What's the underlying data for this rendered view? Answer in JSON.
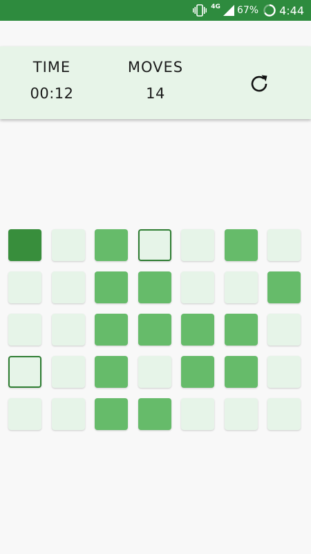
{
  "status_bar": {
    "network": "4G",
    "battery": "67%",
    "time": "4:44",
    "icons": [
      "vibrate-icon",
      "signal-icon",
      "battery-icon"
    ]
  },
  "header": {
    "time_label": "TIME",
    "time_value": "00:12",
    "moves_label": "MOVES",
    "moves_value": "14",
    "restart_icon": "refresh-icon"
  },
  "colors": {
    "status_bar": "#2e8b3e",
    "header_bg": "#e7f4e8",
    "tile_empty": "#e6f4e8",
    "tile_filled": "#66bb6a",
    "tile_dark": "#388e3c",
    "tile_cursor_border": "#2e7d32"
  },
  "board": {
    "rows": [
      [
        "dark",
        "empty",
        "filled",
        "cursor",
        "empty",
        "filled",
        "empty"
      ],
      [
        "empty",
        "empty",
        "filled",
        "filled",
        "empty",
        "empty",
        "filled"
      ],
      [
        "empty",
        "empty",
        "filled",
        "filled",
        "filled",
        "filled",
        "empty"
      ],
      [
        "cursor",
        "empty",
        "filled",
        "empty",
        "filled",
        "filled",
        "empty"
      ],
      [
        "empty",
        "empty",
        "filled",
        "filled",
        "empty",
        "empty",
        "empty"
      ]
    ]
  }
}
